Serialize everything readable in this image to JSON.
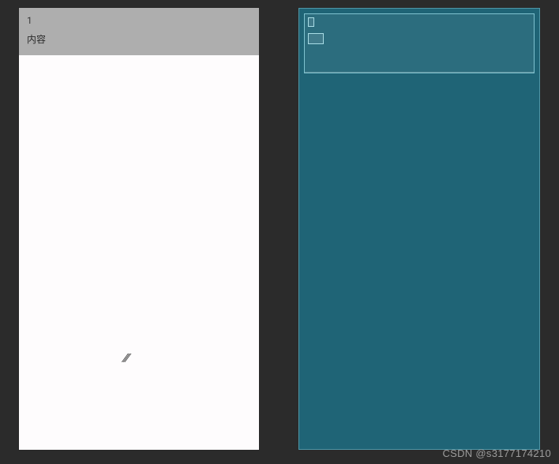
{
  "preview": {
    "panel": {
      "line1": "1",
      "line2": "内容"
    }
  },
  "blueprint": {
    "slots": [
      "text-1",
      "text-content"
    ]
  },
  "watermark": "CSDN @s3177174210"
}
